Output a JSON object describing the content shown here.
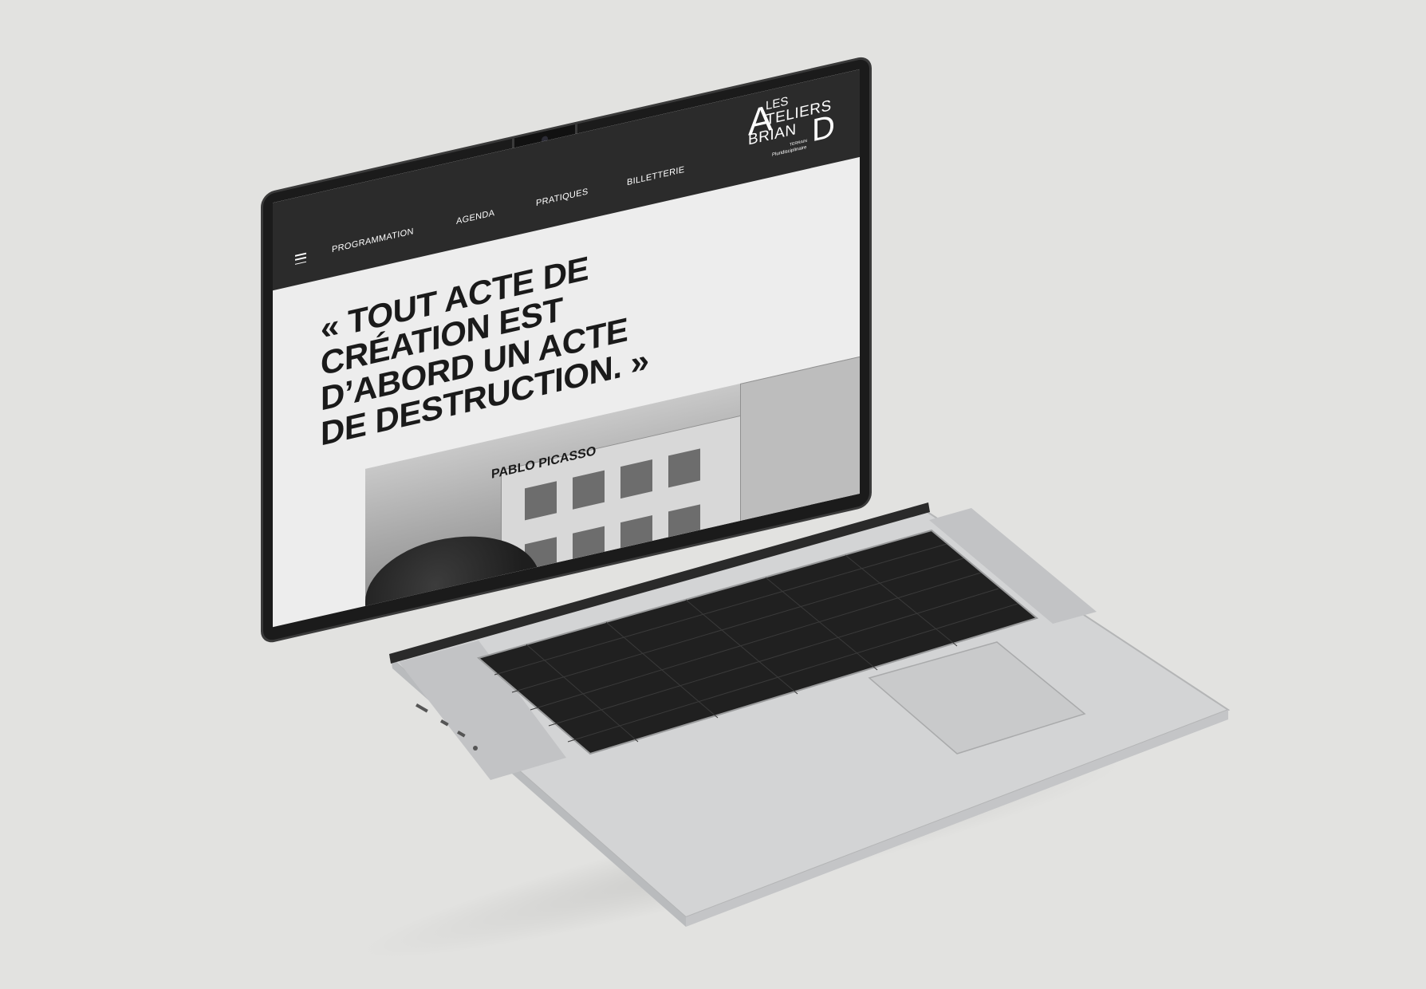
{
  "nav": {
    "menu_icon": "hamburger-menu-icon",
    "items": [
      "PROGRAMMATION",
      "AGENDA",
      "PRATIQUES",
      "BILLETTERIE"
    ]
  },
  "logo": {
    "les": "LES",
    "ateliers": "ATELIERS",
    "briand": "BRIAN",
    "tagline_small": "TERRAIN",
    "tagline": "Pluridisciplinaire"
  },
  "hero": {
    "quote_lines": [
      "« TOUT ACTE DE",
      "CRÉATION EST",
      "D’ABORD UN ACTE",
      "DE DESTRUCTION. »"
    ],
    "author": "PABLO PICASSO"
  },
  "colors": {
    "nav_bg": "#2b2b2b",
    "page_bg": "#ededed",
    "text": "#1a1a1a",
    "laptop_body": "#cfd0d1",
    "keyboard": "#222222"
  }
}
